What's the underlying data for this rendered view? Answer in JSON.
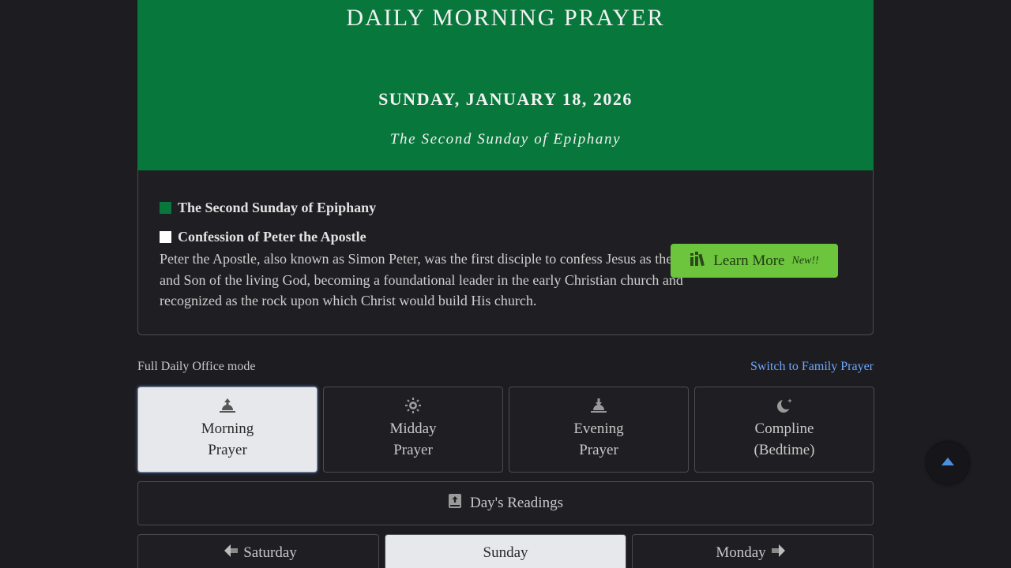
{
  "header": {
    "title": "DAILY MORNING PRAYER",
    "date": "SUNDAY, JANUARY 18, 2026",
    "subtitle": "The Second Sunday of Epiphany",
    "color": "#08773c"
  },
  "observances": [
    {
      "title": "The Second Sunday of Epiphany",
      "color": "green"
    },
    {
      "title": "Confession of Peter the Apostle",
      "color": "white",
      "description": "Peter the Apostle, also known as Simon Peter, was the first disciple to confess Jesus as the Messiah and Son of the living God, becoming a foundational leader in the early Christian church and recognized as the rock upon which Christ would build His church."
    }
  ],
  "learn_more": {
    "label": "Learn More",
    "badge": "New!!",
    "icon": "books-icon",
    "color": "#6cc53c"
  },
  "mode": {
    "label": "Full Daily Office mode",
    "switch_label": "Switch to Family Prayer"
  },
  "offices": [
    {
      "line1": "Morning",
      "line2": "Prayer",
      "icon": "sunrise-icon",
      "active": true
    },
    {
      "line1": "Midday",
      "line2": "Prayer",
      "icon": "sun-icon",
      "active": false
    },
    {
      "line1": "Evening",
      "line2": "Prayer",
      "icon": "sunset-icon",
      "active": false
    },
    {
      "line1": "Compline",
      "line2": "(Bedtime)",
      "icon": "moon-icon",
      "active": false
    }
  ],
  "readings": {
    "label": "Day's Readings",
    "icon": "book-icon"
  },
  "days": {
    "prev": "Saturday",
    "current": "Sunday",
    "next": "Monday"
  },
  "scroll_top": {
    "icon": "caret-up-icon",
    "color": "#4a90e2"
  }
}
